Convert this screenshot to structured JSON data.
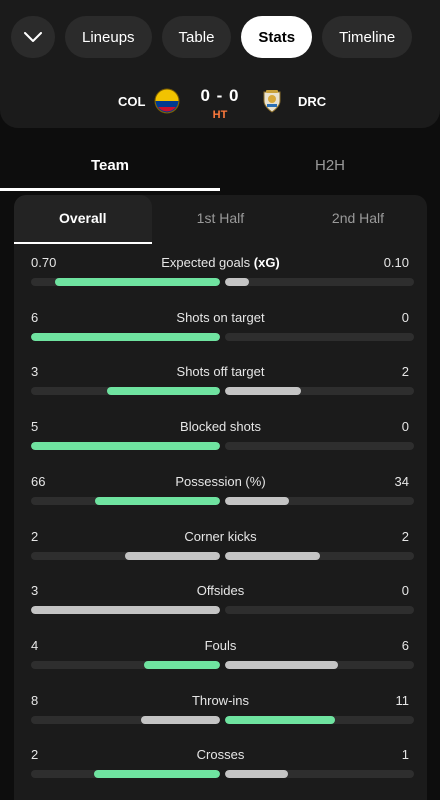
{
  "nav": {
    "tabs": [
      {
        "label": "Lineups",
        "active": false
      },
      {
        "label": "Table",
        "active": false
      },
      {
        "label": "Stats",
        "active": true
      },
      {
        "label": "Timeline",
        "active": false
      }
    ],
    "collapse_icon": "chevron-down-icon"
  },
  "match": {
    "home": {
      "code": "COL",
      "crest_icon": "colombia-crest-icon"
    },
    "away": {
      "code": "DRC",
      "crest_icon": "drc-crest-icon"
    },
    "score": "0 - 0",
    "status": "HT"
  },
  "main_tabs": [
    {
      "label": "Team",
      "active": true
    },
    {
      "label": "H2H",
      "active": false
    }
  ],
  "sub_tabs": [
    {
      "label": "Overall",
      "active": true
    },
    {
      "label": "1st Half",
      "active": false
    },
    {
      "label": "2nd Half",
      "active": false
    }
  ],
  "colors": {
    "highlight": "#6fe3a0",
    "neutral": "#c4c4c4",
    "track": "#2e2e2e",
    "status": "#ff7a3d"
  },
  "stats": [
    {
      "label": "Expected goals",
      "label_suffix": "(xG)",
      "home": "0.70",
      "away": "0.10",
      "home_frac": 0.875,
      "away_frac": 0.125,
      "home_color": "highlight",
      "away_color": "neutral"
    },
    {
      "label": "Shots on target",
      "home": "6",
      "away": "0",
      "home_frac": 1.0,
      "away_frac": 0.0,
      "home_color": "highlight",
      "away_color": "neutral"
    },
    {
      "label": "Shots off target",
      "home": "3",
      "away": "2",
      "home_frac": 0.6,
      "away_frac": 0.4,
      "home_color": "highlight",
      "away_color": "neutral"
    },
    {
      "label": "Blocked shots",
      "home": "5",
      "away": "0",
      "home_frac": 1.0,
      "away_frac": 0.0,
      "home_color": "highlight",
      "away_color": "neutral"
    },
    {
      "label": "Possession (%)",
      "home": "66",
      "away": "34",
      "home_frac": 0.66,
      "away_frac": 0.34,
      "home_color": "highlight",
      "away_color": "neutral"
    },
    {
      "label": "Corner kicks",
      "home": "2",
      "away": "2",
      "home_frac": 0.5,
      "away_frac": 0.5,
      "home_color": "neutral",
      "away_color": "neutral"
    },
    {
      "label": "Offsides",
      "home": "3",
      "away": "0",
      "home_frac": 1.0,
      "away_frac": 0.0,
      "home_color": "neutral",
      "away_color": "neutral"
    },
    {
      "label": "Fouls",
      "home": "4",
      "away": "6",
      "home_frac": 0.4,
      "away_frac": 0.6,
      "home_color": "highlight",
      "away_color": "neutral"
    },
    {
      "label": "Throw-ins",
      "home": "8",
      "away": "11",
      "home_frac": 0.42,
      "away_frac": 0.58,
      "home_color": "neutral",
      "away_color": "highlight"
    },
    {
      "label": "Crosses",
      "home": "2",
      "away": "1",
      "home_frac": 0.667,
      "away_frac": 0.333,
      "home_color": "highlight",
      "away_color": "neutral"
    }
  ]
}
